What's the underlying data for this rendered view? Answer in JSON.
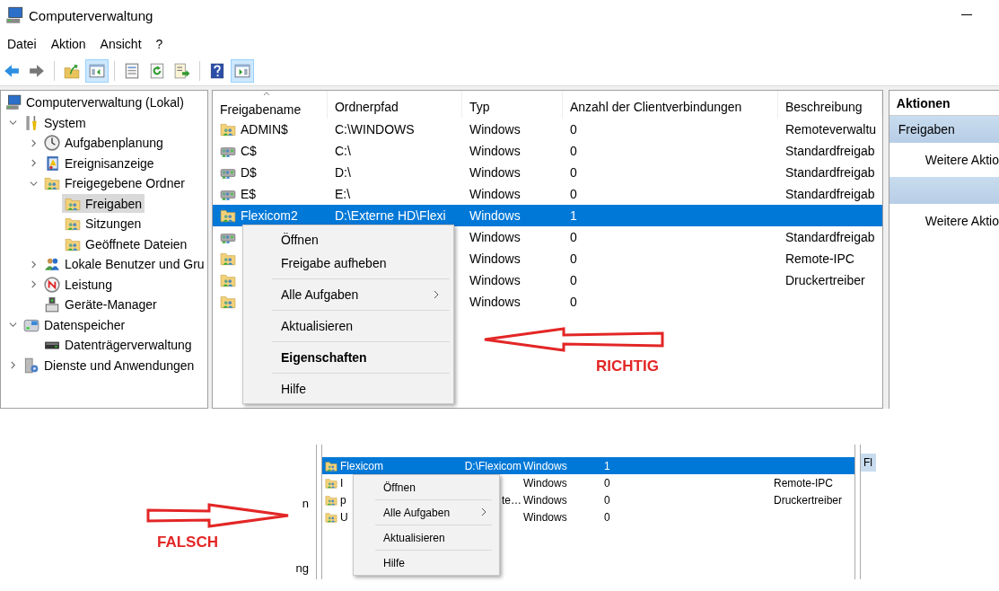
{
  "window": {
    "title": "Computerverwaltung"
  },
  "menu_bar": [
    "Datei",
    "Aktion",
    "Ansicht",
    "?"
  ],
  "toolbar": [
    {
      "kind": "back",
      "pressed": false
    },
    {
      "kind": "forward",
      "pressed": false
    },
    {
      "kind": "separator"
    },
    {
      "kind": "folderup",
      "pressed": false
    },
    {
      "kind": "panelleft",
      "pressed": true
    },
    {
      "kind": "separator"
    },
    {
      "kind": "properties",
      "pressed": false
    },
    {
      "kind": "refresh",
      "pressed": false
    },
    {
      "kind": "export",
      "pressed": false
    },
    {
      "kind": "separator"
    },
    {
      "kind": "help",
      "pressed": false
    },
    {
      "kind": "panelright",
      "pressed": true
    }
  ],
  "tree": [
    {
      "kind": "computer",
      "label": "Computerverwaltung (Lokal)",
      "selected": false,
      "children": [
        {
          "kind": "tools",
          "label": "System",
          "expanded": true,
          "selected": false,
          "children": [
            {
              "kind": "clock",
              "label": "Aufgabenplanung",
              "expanded": false,
              "selected": false
            },
            {
              "kind": "log",
              "label": "Ereignisanzeige",
              "expanded": false,
              "selected": false
            },
            {
              "kind": "sharefolder",
              "label": "Freigegebene Ordner",
              "expanded": true,
              "selected": false,
              "children": [
                {
                  "kind": "sharefolder",
                  "label": "Freigaben",
                  "selected": true
                },
                {
                  "kind": "sharefolder",
                  "label": "Sitzungen",
                  "selected": false
                },
                {
                  "kind": "sharefolder",
                  "label": "Geöffnete Dateien",
                  "selected": false
                }
              ]
            },
            {
              "kind": "users",
              "label": "Lokale Benutzer und Gru",
              "expanded": false,
              "selected": false
            },
            {
              "kind": "gauge",
              "label": "Leistung",
              "expanded": false,
              "selected": false
            },
            {
              "kind": "device",
              "label": "Geräte-Manager",
              "selected": false
            }
          ]
        },
        {
          "kind": "storage",
          "label": "Datenspeicher",
          "expanded": true,
          "selected": false,
          "children": [
            {
              "kind": "disk",
              "label": "Datenträgerverwaltung",
              "selected": false
            }
          ]
        },
        {
          "kind": "services",
          "label": "Dienste und Anwendungen",
          "expanded": false,
          "selected": false
        }
      ]
    }
  ],
  "table": {
    "columns": [
      {
        "label": "Freigabename",
        "sorted": true
      },
      {
        "label": "Ordnerpfad",
        "sorted": false
      },
      {
        "label": "Typ",
        "sorted": false
      },
      {
        "label": "Anzahl der Clientverbindungen",
        "sorted": false
      },
      {
        "label": "Beschreibung",
        "sorted": false
      }
    ],
    "rows": [
      {
        "kind": "folder",
        "name": "ADMIN$",
        "path": "C:\\WINDOWS",
        "type": "Windows",
        "connections": "0",
        "description": "Remoteverwaltu",
        "selected": false
      },
      {
        "kind": "drive",
        "name": "C$",
        "path": "C:\\",
        "type": "Windows",
        "connections": "0",
        "description": "Standardfreigab",
        "selected": false
      },
      {
        "kind": "drive",
        "name": "D$",
        "path": "D:\\",
        "type": "Windows",
        "connections": "0",
        "description": "Standardfreigab",
        "selected": false
      },
      {
        "kind": "drive",
        "name": "E$",
        "path": "E:\\",
        "type": "Windows",
        "connections": "0",
        "description": "Standardfreigab",
        "selected": false
      },
      {
        "kind": "folder",
        "name": "Flexicom2",
        "path": "D:\\Externe HD\\Flexi",
        "type": "Windows",
        "connections": "1",
        "selected": true
      },
      {
        "kind": "drive",
        "type": "Windows",
        "connections": "0",
        "description": "Standardfreigab",
        "selected": false
      },
      {
        "kind": "folder",
        "type": "Windows",
        "connections": "0",
        "description": "Remote-IPC",
        "selected": false
      },
      {
        "kind": "folder",
        "type": "Windows",
        "connections": "0",
        "description": "Druckertreiber",
        "selected": false
      },
      {
        "kind": "folder",
        "type": "Windows",
        "connections": "0",
        "selected": false
      }
    ]
  },
  "context_menu": {
    "items": [
      {
        "kind": "item",
        "label": "Öffnen",
        "bold": false,
        "submenu": false
      },
      {
        "kind": "item",
        "label": "Freigabe aufheben",
        "bold": false,
        "submenu": false
      },
      {
        "kind": "separator"
      },
      {
        "kind": "item",
        "label": "Alle Aufgaben",
        "bold": false,
        "submenu": true
      },
      {
        "kind": "separator"
      },
      {
        "kind": "item",
        "label": "Aktualisieren",
        "bold": false,
        "submenu": false
      },
      {
        "kind": "separator"
      },
      {
        "kind": "item",
        "label": "Eigenschaften",
        "bold": true,
        "submenu": false
      },
      {
        "kind": "separator"
      },
      {
        "kind": "item",
        "label": "Hilfe",
        "bold": false,
        "submenu": false
      }
    ]
  },
  "actions": {
    "title": "Aktionen",
    "sections": [
      {
        "title": "Freigaben",
        "items": [
          "Weitere Aktio"
        ]
      },
      {
        "items": [
          "Weitere Aktio"
        ]
      }
    ]
  },
  "inset": {
    "tree_fragments": [
      "n",
      "ng"
    ],
    "rows": [
      {
        "kind": "folder",
        "name": "Flexicom",
        "path": "D:\\Flexicom",
        "type": "Windows",
        "connections": "1",
        "selected": true
      },
      {
        "kind": "folder",
        "name": "I",
        "type": "Windows",
        "connections": "0",
        "description": "Remote-IPC",
        "selected": false
      },
      {
        "kind": "folder",
        "name": "p",
        "path": "te…",
        "type": "Windows",
        "connections": "0",
        "description": "Druckertreiber",
        "selected": false
      },
      {
        "kind": "folder",
        "name": "U",
        "type": "Windows",
        "connections": "0",
        "selected": false
      }
    ],
    "context_menu": {
      "items": [
        {
          "kind": "item",
          "label": "Öffnen",
          "bold": false,
          "submenu": false
        },
        {
          "kind": "separator"
        },
        {
          "kind": "item",
          "label": "Alle Aufgaben",
          "bold": false,
          "submenu": true
        },
        {
          "kind": "separator"
        },
        {
          "kind": "item",
          "label": "Aktualisieren",
          "bold": false,
          "submenu": false
        },
        {
          "kind": "separator"
        },
        {
          "kind": "item",
          "label": "Hilfe",
          "bold": false,
          "submenu": false
        }
      ]
    },
    "actions_fragment": "Fl"
  },
  "annotations": [
    {
      "label": "RICHTIG",
      "kind": "leftarrow"
    },
    {
      "label": "FALSCH",
      "kind": "rightarrow"
    }
  ]
}
